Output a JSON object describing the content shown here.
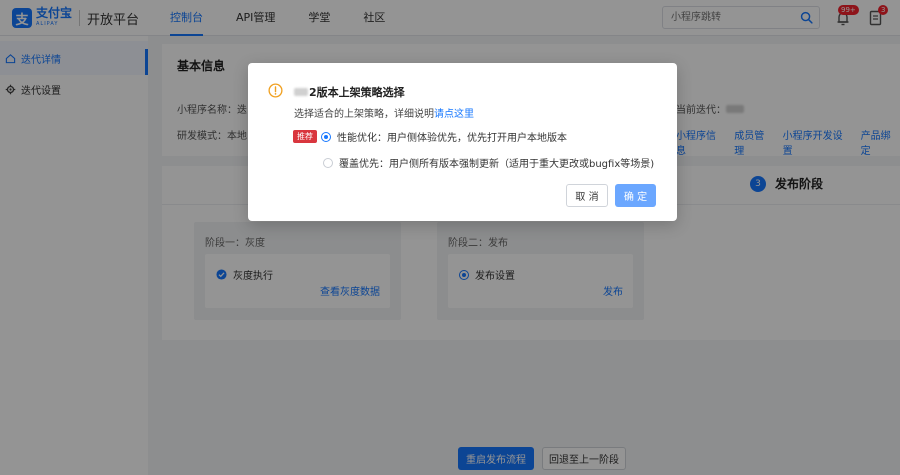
{
  "header": {
    "logo_cn": "支付宝",
    "logo_en": "ALIPAY",
    "platform": "开放平台",
    "nav": [
      "控制台",
      "API管理",
      "学堂",
      "社区"
    ],
    "search_placeholder": "小程序跳转",
    "message_badge": "99+",
    "task_badge": "3"
  },
  "sidebar": {
    "items": [
      "迭代详情",
      "迭代设置"
    ]
  },
  "basic_info": {
    "title": "基本信息",
    "name_label": "小程序名称：迭",
    "mode_label": "研发模式：本地",
    "current_label": "当前迭代：",
    "links": [
      "小程序信息",
      "成员管理",
      "小程序开发设置",
      "产品绑定"
    ]
  },
  "stages": {
    "step_number": "3",
    "step_label": "发布阶段",
    "phase1": {
      "label": "阶段一：灰度",
      "item": "灰度执行",
      "link": "查看灰度数据"
    },
    "phase2": {
      "label": "阶段二：发布",
      "item": "发布设置",
      "link": "发布"
    }
  },
  "footer_buttons": {
    "restart": "重启发布流程",
    "rollback": "回退至上一阶段"
  },
  "modal": {
    "title_suffix": "2版本上架策略选择",
    "desc_text": "选择适合的上架策略，详细说明",
    "desc_link": "请点这里",
    "recommend_tag": "推荐",
    "option1": "性能优化：用户侧体验优先，优先打开用户本地版本",
    "option2": "覆盖优先：用户侧所有版本强制更新（适用于重大更改或bugfix等场景)",
    "cancel": "取 消",
    "confirm": "确 定"
  }
}
